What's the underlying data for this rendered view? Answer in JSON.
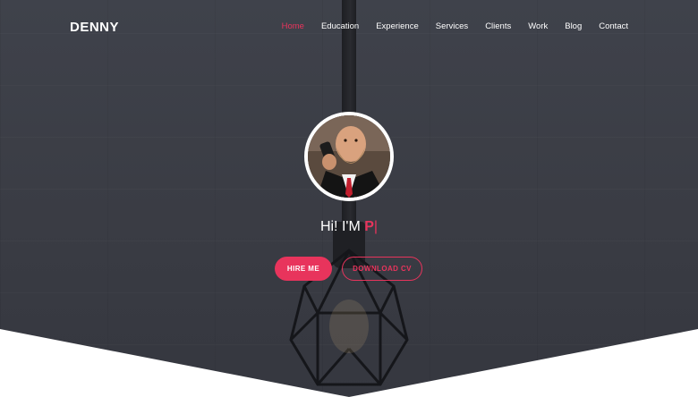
{
  "brand": {
    "logo_text": "DENNY"
  },
  "nav": {
    "items": [
      {
        "label": "Home",
        "active": true
      },
      {
        "label": "Education",
        "active": false
      },
      {
        "label": "Experience",
        "active": false
      },
      {
        "label": "Services",
        "active": false
      },
      {
        "label": "Clients",
        "active": false
      },
      {
        "label": "Work",
        "active": false
      },
      {
        "label": "Blog",
        "active": false
      },
      {
        "label": "Contact",
        "active": false
      }
    ]
  },
  "hero": {
    "greeting": "Hi! I'M ",
    "typed_text": "P",
    "cursor": "|",
    "buttons": {
      "hire": "HIRE ME",
      "download": "DOWNLOAD CV"
    }
  },
  "colors": {
    "accent": "#e8345c",
    "background": "#3d3f47",
    "text": "#ffffff"
  },
  "icons": [
    "profile-photo"
  ]
}
